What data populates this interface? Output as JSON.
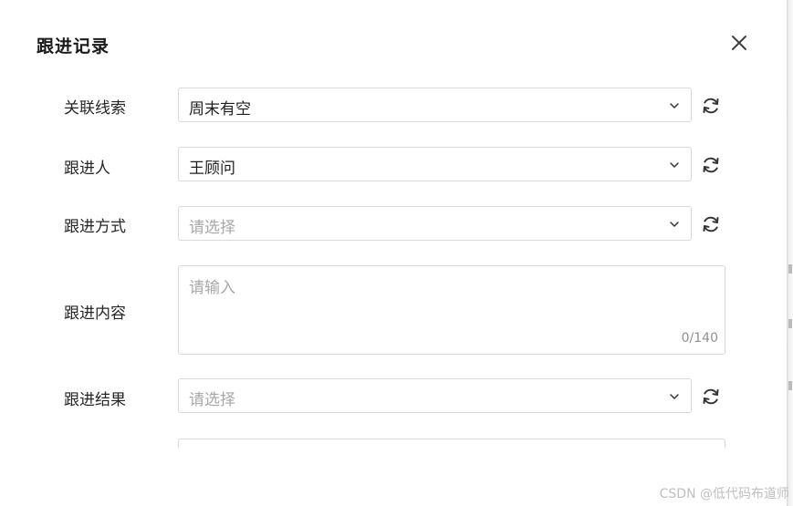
{
  "dialog": {
    "title": "跟进记录",
    "close_icon": "close-icon"
  },
  "form": {
    "related_clue": {
      "label": "关联线索",
      "value": "周末有空",
      "icon": "chevron-down-icon",
      "refresh_icon": "refresh-icon"
    },
    "follower": {
      "label": "跟进人",
      "value": "王顾问",
      "icon": "chevron-down-icon",
      "refresh_icon": "refresh-icon"
    },
    "method": {
      "label": "跟进方式",
      "placeholder": "请选择",
      "icon": "chevron-down-icon",
      "refresh_icon": "refresh-icon"
    },
    "content": {
      "label": "跟进内容",
      "placeholder": "请输入",
      "counter": "0/140"
    },
    "result": {
      "label": "跟进结果",
      "placeholder": "请选择",
      "icon": "chevron-down-icon",
      "refresh_icon": "refresh-icon"
    }
  },
  "watermark": "CSDN @低代码布道师",
  "colors": {
    "border": "#d9d9d9",
    "placeholder": "#a8a8a8",
    "text": "#1f1f1f"
  }
}
